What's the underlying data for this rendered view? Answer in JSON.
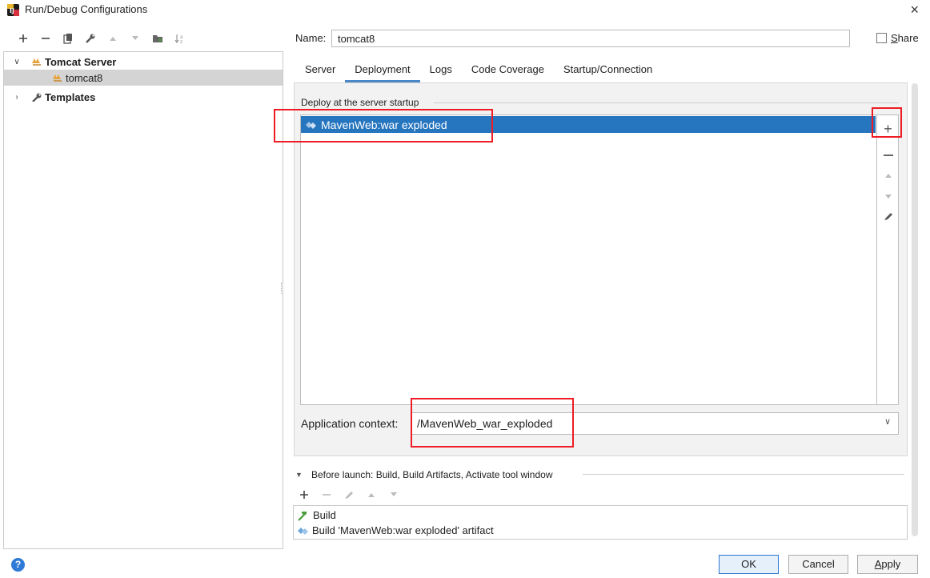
{
  "window": {
    "title": "Run/Debug Configurations",
    "close_glyph": "×"
  },
  "left_toolbar": {
    "icons": [
      "add-icon",
      "remove-icon",
      "copy-icon",
      "wrench-icon",
      "move-up-icon",
      "move-down-icon",
      "folder-icon",
      "sort-icon"
    ]
  },
  "tree": {
    "items": [
      {
        "label": "Tomcat Server",
        "expanded": true
      },
      {
        "label": "tomcat8",
        "selected": true
      },
      {
        "label": "Templates",
        "expanded": false
      }
    ]
  },
  "config": {
    "name_label": "Name:",
    "name_value": "tomcat8",
    "share_label": "Share",
    "share_checked": false
  },
  "tabs": [
    {
      "label": "Server"
    },
    {
      "label": "Deployment",
      "active": true
    },
    {
      "label": "Logs"
    },
    {
      "label": "Code Coverage"
    },
    {
      "label": "Startup/Connection"
    }
  ],
  "deployment": {
    "section_title": "Deploy at the server startup",
    "artifacts": [
      {
        "label": "MavenWeb:war exploded",
        "selected": true
      }
    ],
    "side_toolbar": [
      "add-icon",
      "remove-icon",
      "move-up-icon",
      "move-down-icon",
      "edit-icon"
    ],
    "app_context_label": "Application context:",
    "app_context_value": "/MavenWeb_war_exploded"
  },
  "before_launch": {
    "title": "Before launch: Build, Build Artifacts, Activate tool window",
    "toolbar": [
      "add-icon",
      "remove-icon",
      "edit-icon",
      "move-up-icon",
      "move-down-icon"
    ],
    "items": [
      {
        "label": "Build",
        "icon": "hammer-icon"
      },
      {
        "label": "Build 'MavenWeb:war exploded' artifact",
        "icon": "artifact-icon"
      }
    ]
  },
  "buttons": {
    "ok": "OK",
    "cancel": "Cancel",
    "apply": "Apply"
  },
  "colors": {
    "selection": "#2675bf",
    "tab_underline": "#4a88c7",
    "annotation_red": "#ee1c24",
    "help_blue": "#2e7ad6"
  }
}
